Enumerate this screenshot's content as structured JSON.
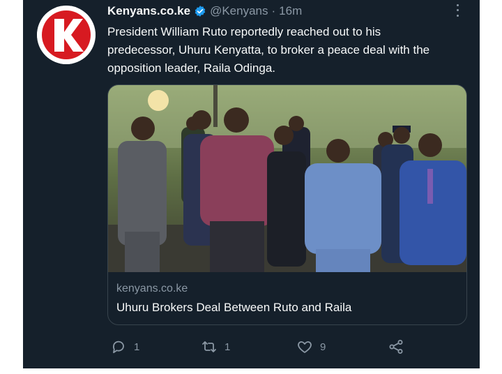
{
  "tweet": {
    "display_name": "Kenyans.co.ke",
    "handle": "@Kenyans",
    "separator": "·",
    "time": "16m",
    "avatar_letter": "K",
    "text": "President William Ruto reportedly reached out to his predecessor, Uhuru Kenyatta, to broker a peace deal with the opposition leader, Raila Odinga."
  },
  "card": {
    "domain": "kenyans.co.ke",
    "title": "Uhuru Brokers Deal Between Ruto and Raila"
  },
  "actions": {
    "reply_count": "1",
    "retweet_count": "1",
    "like_count": "9"
  },
  "colors": {
    "background": "#15202b",
    "text": "#f7f9f9",
    "muted": "#8b98a5",
    "verified": "#1d9bf0",
    "brand_red": "#d71a21"
  },
  "icons": [
    "verified-badge-icon",
    "more-icon",
    "reply-icon",
    "retweet-icon",
    "like-icon",
    "share-icon"
  ]
}
